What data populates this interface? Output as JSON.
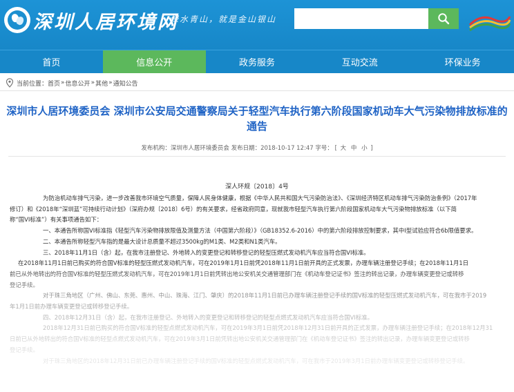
{
  "header": {
    "site_title": "深圳人居环境网",
    "slogan": "绿水青山，就是金山银山",
    "search_placeholder": "",
    "right_logo_text": "深圳环境"
  },
  "nav": {
    "items": [
      {
        "label": "首页"
      },
      {
        "label": "信息公开"
      },
      {
        "label": "政务服务"
      },
      {
        "label": "互动交流"
      },
      {
        "label": "环保业务"
      }
    ],
    "active_index": 1
  },
  "breadcrumb": {
    "prefix": "当前位置：",
    "items": [
      "首页",
      "信息公开",
      "其他",
      "通知公告"
    ],
    "separator": "»"
  },
  "article": {
    "title": "深圳市人居环境委员会 深圳市公安局交通警察局关于轻型汽车执行第六阶段国家机动车大气污染物排放标准的通告",
    "meta_source": "发布机构：深圳市人居环境委员会",
    "meta_date": "发布日期：2018-10-17 12:47",
    "meta_size_label": "字号：",
    "size_large": "大",
    "size_medium": "中",
    "size_small": "小",
    "doc_number": "深人环规〔2018〕4号",
    "paragraphs": [
      "为防治机动车排气污染，进一步改善我市环境空气质量，保障人民身体健康，根据《中华人民共和国大气污染防治法》、《深圳经济特区机动车排气污染防治条例》（2017年",
      "修订）和《2018年“深圳蓝”可持续行动计划》（深府办规〔2018〕6号）的有关要求，经省政府同意，现就我市轻型汽车执行第六阶段国家机动车大气污染物排放标准（以下简",
      "称“国VI标准”）有关事项通告如下：",
      "一、本通告所称国VI标准指《轻型汽车污染物排放限值及测量方法（中国第六阶段）》（GB18352.6-2016）中的第六阶段排放控制要求，其中Ⅰ型试验应符合6b限值要求。",
      "二、本通告所称轻型汽车指的是最大设计总质量不超过3500kg的M1类、M2类和N1类汽车。",
      "三、2018年11月1日（含）起，在我市注册登记、外地转入的变更登记和转移登记的轻型压燃式发动机汽车应当符合国VI标准。",
      "在2018年11月1日前已购买的符合国Ⅴ标准的轻型压燃式发动机汽车，可在2019年1月1日前凭2018年11月1日前开具的正式发票，办理车辆注册登记手续；在2018年11月1日",
      "前已从外地转出的符合国Ⅴ标准的轻型压燃式发动机汽车，可在2019年1月1日前凭转出地公安机关交通管理部门在《机动车登记证书》签注的转出记录，办理车辆变更登记或转移",
      "登记手续。",
      "对于珠三角地区（广州、佛山、东莞、惠州、中山、珠海、江门、肇庆）的2018年11月1日前已办理车辆注册登记手续的国Ⅴ标准的轻型压燃式发动机汽车，可在我市于2019",
      "年1月1日前办理车辆变更登记或转移登记手续。",
      "四、2018年12月31日（含）起，在我市注册登记、外地转入的变更登记和转移登记的轻型点燃式发动机汽车应当符合国VI标准。",
      "2018年12月31日前已购买的符合国Ⅴ标准的轻型点燃式发动机汽车，可在2019年3月1日前凭2018年12月31日前开具的正式发票，办理车辆注册登记手续；在2018年12月31",
      "日前已从外地转出的符合国Ⅴ标准的轻型点燃式发动机汽车，可在2019年3月1日前凭转出地公安机关交通管理部门在《机动车登记证书》签注的转出记录，办理车辆变更登记或转移",
      "登记手续。",
      "对于珠三角地区的2018年12月31日前已办理车辆注册登记手续的国Ⅴ标准的轻型点燃式发动机汽车，可在我市于2019年3月1日前办理车辆变更登记或转移登记手续。"
    ]
  },
  "colors": {
    "header_blue": "#1b8fd0",
    "nav_active_green": "#5cb85c",
    "title_blue": "#1f63c5"
  }
}
